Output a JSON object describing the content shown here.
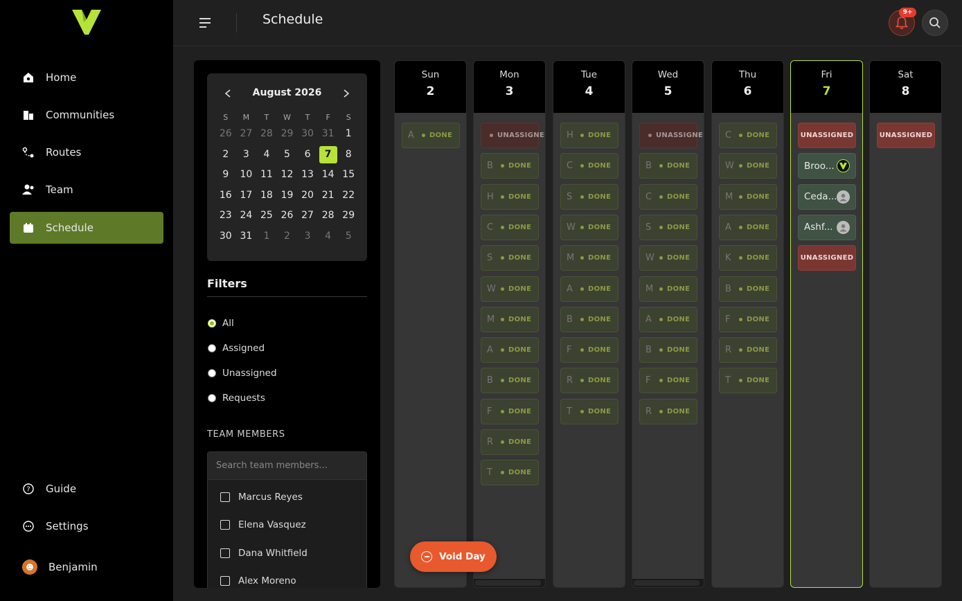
{
  "sidebar": {
    "nav": [
      {
        "label": "Home",
        "icon": "home-icon"
      },
      {
        "label": "Communities",
        "icon": "communities-icon"
      },
      {
        "label": "Routes",
        "icon": "routes-icon"
      },
      {
        "label": "Team",
        "icon": "team-icon"
      },
      {
        "label": "Schedule",
        "icon": "calendar-icon",
        "active": true
      }
    ],
    "bottom": [
      {
        "label": "Guide",
        "icon": "help-icon"
      },
      {
        "label": "Settings",
        "icon": "settings-icon"
      }
    ],
    "user": {
      "name": "Benjamin"
    }
  },
  "topbar": {
    "title": "Schedule",
    "notifications_badge": "9+"
  },
  "calendar": {
    "month_label": "August 2026",
    "weekdays": [
      "S",
      "M",
      "T",
      "W",
      "T",
      "F",
      "S"
    ],
    "days": [
      {
        "d": "26",
        "muted": true
      },
      {
        "d": "27",
        "muted": true
      },
      {
        "d": "28",
        "muted": true
      },
      {
        "d": "29",
        "muted": true
      },
      {
        "d": "30",
        "muted": true
      },
      {
        "d": "31",
        "muted": true
      },
      {
        "d": "1"
      },
      {
        "d": "2"
      },
      {
        "d": "3"
      },
      {
        "d": "4"
      },
      {
        "d": "5"
      },
      {
        "d": "6"
      },
      {
        "d": "7",
        "today": true
      },
      {
        "d": "8"
      },
      {
        "d": "9"
      },
      {
        "d": "10"
      },
      {
        "d": "11"
      },
      {
        "d": "12"
      },
      {
        "d": "13"
      },
      {
        "d": "14"
      },
      {
        "d": "15"
      },
      {
        "d": "16"
      },
      {
        "d": "17"
      },
      {
        "d": "18"
      },
      {
        "d": "19"
      },
      {
        "d": "20"
      },
      {
        "d": "21"
      },
      {
        "d": "22"
      },
      {
        "d": "23"
      },
      {
        "d": "24"
      },
      {
        "d": "25"
      },
      {
        "d": "26"
      },
      {
        "d": "27"
      },
      {
        "d": "28"
      },
      {
        "d": "29"
      },
      {
        "d": "30"
      },
      {
        "d": "31"
      },
      {
        "d": "1",
        "muted": true
      },
      {
        "d": "2",
        "muted": true
      },
      {
        "d": "3",
        "muted": true
      },
      {
        "d": "4",
        "muted": true
      },
      {
        "d": "5",
        "muted": true
      }
    ]
  },
  "filters": {
    "title": "Filters",
    "options": [
      "All",
      "Assigned",
      "Unassigned",
      "Requests"
    ],
    "selected": "All"
  },
  "team": {
    "title": "TEAM MEMBERS",
    "search_placeholder": "Search team members...",
    "members": [
      "Marcus Reyes",
      "Elena Vasquez",
      "Dana Whitfield",
      "Alex Moreno"
    ]
  },
  "week": [
    {
      "dow": "Sun",
      "num": "2",
      "cards": [
        {
          "name": "A",
          "status": "DONE"
        }
      ]
    },
    {
      "dow": "Mon",
      "num": "3",
      "cards": [
        {
          "name": "",
          "status": "UNASSIGNED",
          "kind": "un"
        },
        {
          "name": "B",
          "status": "DONE"
        },
        {
          "name": "H",
          "status": "DONE"
        },
        {
          "name": "C",
          "status": "DONE"
        },
        {
          "name": "S",
          "status": "DONE"
        },
        {
          "name": "W",
          "status": "DONE"
        },
        {
          "name": "M",
          "status": "DONE"
        },
        {
          "name": "A",
          "status": "DONE"
        },
        {
          "name": "B",
          "status": "DONE"
        },
        {
          "name": "F",
          "status": "DONE"
        },
        {
          "name": "R",
          "status": "DONE"
        },
        {
          "name": "T",
          "status": "DONE"
        }
      ]
    },
    {
      "dow": "Tue",
      "num": "4",
      "cards": [
        {
          "name": "H",
          "status": "DONE"
        },
        {
          "name": "C",
          "status": "DONE"
        },
        {
          "name": "S",
          "status": "DONE"
        },
        {
          "name": "W",
          "status": "DONE"
        },
        {
          "name": "M",
          "status": "DONE"
        },
        {
          "name": "A",
          "status": "DONE"
        },
        {
          "name": "B",
          "status": "DONE"
        },
        {
          "name": "F",
          "status": "DONE"
        },
        {
          "name": "R",
          "status": "DONE"
        },
        {
          "name": "T",
          "status": "DONE"
        }
      ]
    },
    {
      "dow": "Wed",
      "num": "5",
      "cards": [
        {
          "name": "",
          "status": "UNASSIGNED",
          "kind": "un"
        },
        {
          "name": "B",
          "status": "DONE"
        },
        {
          "name": "C",
          "status": "DONE"
        },
        {
          "name": "S",
          "status": "DONE"
        },
        {
          "name": "W",
          "status": "DONE"
        },
        {
          "name": "M",
          "status": "DONE"
        },
        {
          "name": "A",
          "status": "DONE"
        },
        {
          "name": "B",
          "status": "DONE"
        },
        {
          "name": "F",
          "status": "DONE"
        },
        {
          "name": "R",
          "status": "DONE"
        }
      ]
    },
    {
      "dow": "Thu",
      "num": "6",
      "cards": [
        {
          "name": "C",
          "status": "DONE"
        },
        {
          "name": "W",
          "status": "DONE"
        },
        {
          "name": "M",
          "status": "DONE"
        },
        {
          "name": "A",
          "status": "DONE"
        },
        {
          "name": "K",
          "status": "DONE"
        },
        {
          "name": "B",
          "status": "DONE"
        },
        {
          "name": "F",
          "status": "DONE"
        },
        {
          "name": "R",
          "status": "DONE"
        },
        {
          "name": "T",
          "status": "DONE"
        }
      ]
    },
    {
      "dow": "Fri",
      "num": "7",
      "today": true,
      "cards": [
        {
          "name": "",
          "status": "UNASSIGNED",
          "kind": "un-active"
        },
        {
          "name": "Broo...",
          "kind": "assigned",
          "avatar": "logo"
        },
        {
          "name": "Ceda...",
          "kind": "assigned",
          "avatar": "person"
        },
        {
          "name": "Ashf...",
          "kind": "assigned",
          "avatar": "person"
        },
        {
          "name": "",
          "status": "UNASSIGNED",
          "kind": "un-active"
        }
      ]
    },
    {
      "dow": "Sat",
      "num": "8",
      "cards": [
        {
          "name": "",
          "status": "UNASSIGNED",
          "kind": "un-active"
        }
      ]
    }
  ],
  "void_button": {
    "label": "Void Day"
  },
  "colors": {
    "accent": "#b6e33a",
    "nav_active": "#5e7a29",
    "danger": "#e9592e",
    "badge": "#e53b2c"
  }
}
